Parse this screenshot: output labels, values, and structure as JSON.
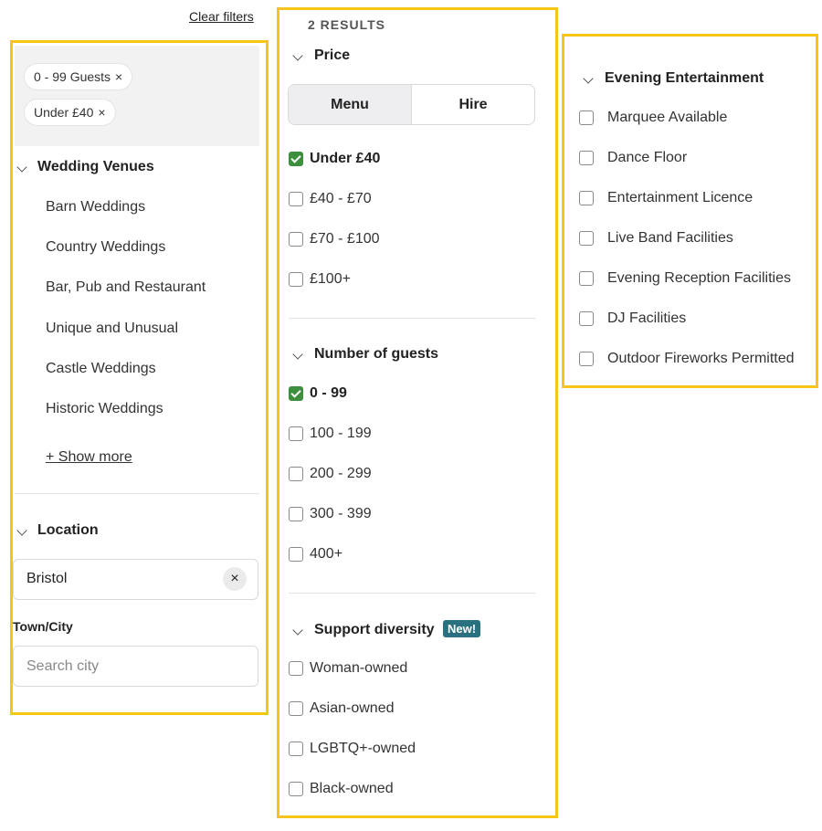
{
  "clear_filters_label": "Clear filters",
  "active_filters": [
    {
      "label": "0 - 99 Guests",
      "remove": "×"
    },
    {
      "label": "Under £40",
      "remove": "×"
    }
  ],
  "wedding_venues": {
    "title": "Wedding Venues",
    "items": [
      "Barn Weddings",
      "Country Weddings",
      "Bar, Pub and Restaurant",
      "Unique and Unusual",
      "Castle Weddings",
      "Historic Weddings"
    ],
    "show_more": "+ Show more"
  },
  "location": {
    "title": "Location",
    "value": "Bristol",
    "clear_icon": "×",
    "town_label": "Town/City",
    "town_placeholder": "Search city"
  },
  "results": {
    "count_label": "2 RESULTS"
  },
  "price": {
    "title": "Price",
    "tabs": [
      {
        "label": "Menu",
        "active": true
      },
      {
        "label": "Hire",
        "active": false
      }
    ],
    "options": [
      {
        "label": "Under £40",
        "checked": true
      },
      {
        "label": "£40 - £70",
        "checked": false
      },
      {
        "label": "£70 - £100",
        "checked": false
      },
      {
        "label": "£100+",
        "checked": false
      }
    ]
  },
  "guests": {
    "title": "Number of guests",
    "options": [
      {
        "label": "0 - 99",
        "checked": true
      },
      {
        "label": "100 - 199",
        "checked": false
      },
      {
        "label": "200 - 299",
        "checked": false
      },
      {
        "label": "300 - 399",
        "checked": false
      },
      {
        "label": "400+",
        "checked": false
      }
    ]
  },
  "diversity": {
    "title": "Support diversity",
    "badge": "New!",
    "options": [
      {
        "label": "Woman-owned",
        "checked": false
      },
      {
        "label": "Asian-owned",
        "checked": false
      },
      {
        "label": "LGBTQ+-owned",
        "checked": false
      },
      {
        "label": "Black-owned",
        "checked": false
      }
    ]
  },
  "entertainment": {
    "title": "Evening Entertainment",
    "options": [
      {
        "label": "Marquee Available",
        "checked": false
      },
      {
        "label": "Dance Floor",
        "checked": false
      },
      {
        "label": "Entertainment Licence",
        "checked": false
      },
      {
        "label": "Live Band Facilities",
        "checked": false
      },
      {
        "label": "Evening Reception Facilities",
        "checked": false
      },
      {
        "label": "DJ Facilities",
        "checked": false
      },
      {
        "label": "Outdoor Fireworks Permitted",
        "checked": false
      }
    ]
  },
  "colors": {
    "highlight": "#f5c518",
    "checked_green": "#3d8f3d",
    "badge_teal": "#2a7180"
  },
  "icons": {
    "chevron": "chevron-down-icon",
    "close": "close-icon",
    "check": "checkmark-icon"
  }
}
